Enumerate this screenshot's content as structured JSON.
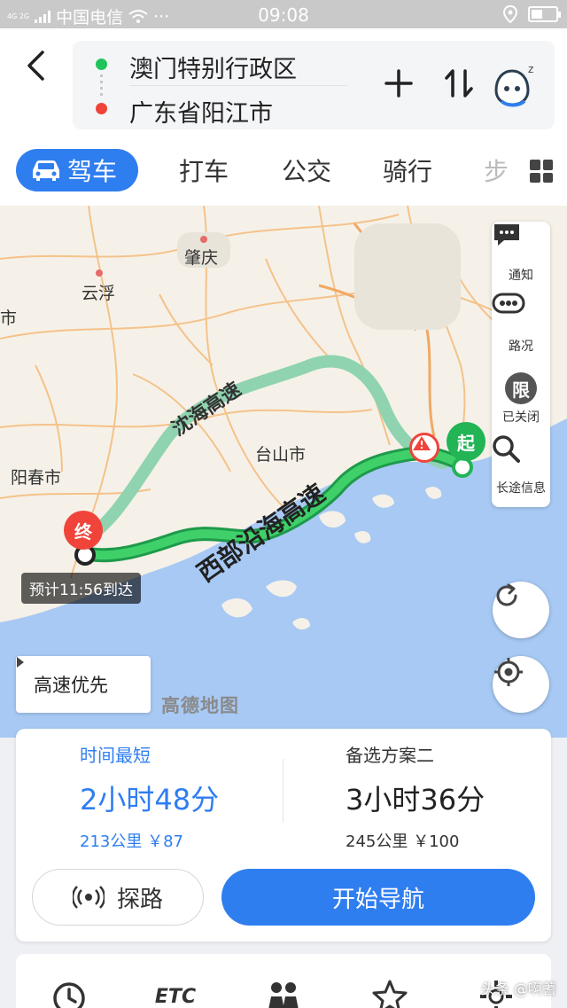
{
  "status_bar": {
    "carrier": "中国电信",
    "time": "09:08",
    "signal_text": "4G 2G"
  },
  "route": {
    "origin": "澳门特别行政区",
    "destination": "广东省阳江市"
  },
  "tabs": [
    {
      "label": "驾车",
      "active": true
    },
    {
      "label": "打车"
    },
    {
      "label": "公交"
    },
    {
      "label": "骑行"
    },
    {
      "label": "步"
    }
  ],
  "map": {
    "cities": [
      "肇庆",
      "云浮",
      "台山市",
      "阳春市",
      "市"
    ],
    "roads": {
      "main": "西部沿海高速",
      "alt": "沈海高速"
    },
    "start_label": "起",
    "end_label": "终",
    "eta": "预计11:56到达",
    "logo_text": "高德地图"
  },
  "tools": [
    {
      "label": "通知",
      "icon": "message-icon"
    },
    {
      "label": "路况",
      "icon": "traffic-icon"
    },
    {
      "label": "已关闭",
      "icon": "restriction-icon",
      "glyph": "限"
    },
    {
      "label": "长途信息",
      "icon": "search-icon"
    }
  ],
  "prefer": {
    "label": "高速优先"
  },
  "options": [
    {
      "name": "时间最短",
      "time": "2小时48分",
      "distance": "213公里",
      "fee": "￥87",
      "selected": true
    },
    {
      "name": "备选方案二",
      "time": "3小时36分",
      "distance": "245公里",
      "fee": "￥100",
      "selected": false
    }
  ],
  "actions": {
    "explore": "探路",
    "navigate": "开始导航"
  },
  "bottom_bar": {
    "etc_label": "ETC"
  },
  "watermark": "头条 @啊蓍",
  "colors": {
    "accent": "#2f7ef0",
    "route_green": "#22b455",
    "alt_route": "#8fd3b0",
    "sea": "#a7c9f4",
    "land": "#f5f1e8",
    "danger": "#f0443b"
  }
}
